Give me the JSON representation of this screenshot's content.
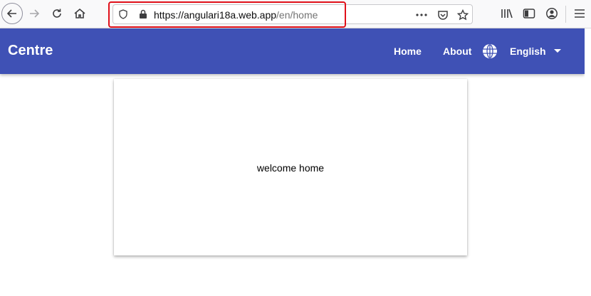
{
  "browser": {
    "url_host": "https://angulari18a.web.app",
    "url_path": "/en/home"
  },
  "app": {
    "brand": "Centre",
    "nav": {
      "home": "Home",
      "about": "About"
    },
    "language": "English",
    "accent_color": "#3f51b5"
  },
  "main": {
    "card_text": "welcome home"
  },
  "icons": [
    "back-arrow-icon",
    "forward-arrow-icon",
    "reload-icon",
    "home-icon",
    "shield-icon",
    "lock-icon",
    "more-dots-icon",
    "pocket-icon",
    "star-icon",
    "library-icon",
    "sidebar-icon",
    "account-icon",
    "hamburger-menu-icon",
    "globe-icon",
    "chevron-down-icon"
  ]
}
